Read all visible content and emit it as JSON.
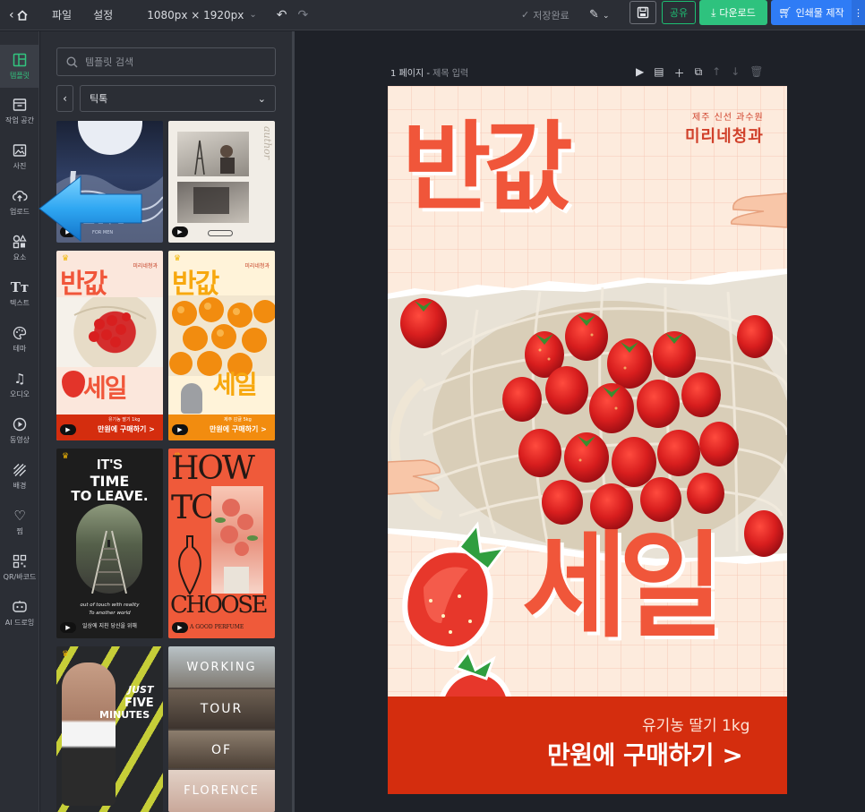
{
  "topbar": {
    "home_glyph": "⌂",
    "menus": [
      "파일",
      "설정"
    ],
    "size_label": "1080px × 1920px",
    "saved_label": "저장완료",
    "share_label": "공유",
    "download_label": "다운로드",
    "print_label": "인쇄물 제작"
  },
  "rail": {
    "items": [
      {
        "label": "템플릿",
        "icon": "template-icon",
        "active": true
      },
      {
        "label": "작업 공간",
        "icon": "workspace-icon"
      },
      {
        "label": "사진",
        "icon": "photo-icon"
      },
      {
        "label": "업로드",
        "icon": "upload-icon"
      },
      {
        "label": "요소",
        "icon": "elements-icon"
      },
      {
        "label": "텍스트",
        "icon": "text-icon"
      },
      {
        "label": "테마",
        "icon": "palette-icon"
      },
      {
        "label": "오디오",
        "icon": "audio-icon"
      },
      {
        "label": "동영상",
        "icon": "video-icon"
      },
      {
        "label": "배경",
        "icon": "background-icon"
      },
      {
        "label": "찜",
        "icon": "heart-icon"
      },
      {
        "label": "QR/바코드",
        "icon": "qr-icon"
      },
      {
        "label": "AI 드로잉",
        "icon": "ai-drawing-icon"
      }
    ]
  },
  "panel": {
    "search_placeholder": "템플릿 검색",
    "category": "틱톡",
    "templates": [
      {
        "id": "t1",
        "texts": [
          "CENT",
          "FOR MEN"
        ]
      },
      {
        "id": "t2",
        "texts": [
          "author"
        ]
      },
      {
        "id": "t3",
        "texts": [
          "반값",
          "세일",
          "미리네청과",
          "유기농 딸기 1kg",
          "만원에 구매하기 >"
        ]
      },
      {
        "id": "t4",
        "texts": [
          "반값",
          "세일",
          "미리네청과",
          "제주 감귤 5kg",
          "만원에 구매하기 >"
        ]
      },
      {
        "id": "t5",
        "texts": [
          "IT'S",
          "TIME",
          "TO LEAVE.",
          "out of touch with reality",
          "To another world",
          "일상에 지친 당신을 위해"
        ]
      },
      {
        "id": "t6",
        "texts": [
          "HOW",
          "TO",
          "CHOOSE",
          "A GOOD PERFUME"
        ]
      },
      {
        "id": "t7",
        "texts": [
          "JUST",
          "FIVE",
          "MINUTES"
        ]
      },
      {
        "id": "t8",
        "texts": [
          "WORKING",
          "TOUR",
          "OF",
          "FLORENCE"
        ]
      }
    ]
  },
  "canvas": {
    "page_label": "1 페이지 -",
    "page_title_placeholder": "제목 입력",
    "design": {
      "brand_small": "제주 신선 과수원",
      "brand": "미리네청과",
      "headline_top": "반값",
      "headline_bottom": "세일",
      "product": "유기농 딸기 1kg",
      "cta": "만원에 구매하기 >"
    }
  },
  "colors": {
    "accent_green": "#2ec27e",
    "accent_blue": "#2f7cf6",
    "design_red": "#f0563a",
    "design_bar": "#d42d0e"
  }
}
